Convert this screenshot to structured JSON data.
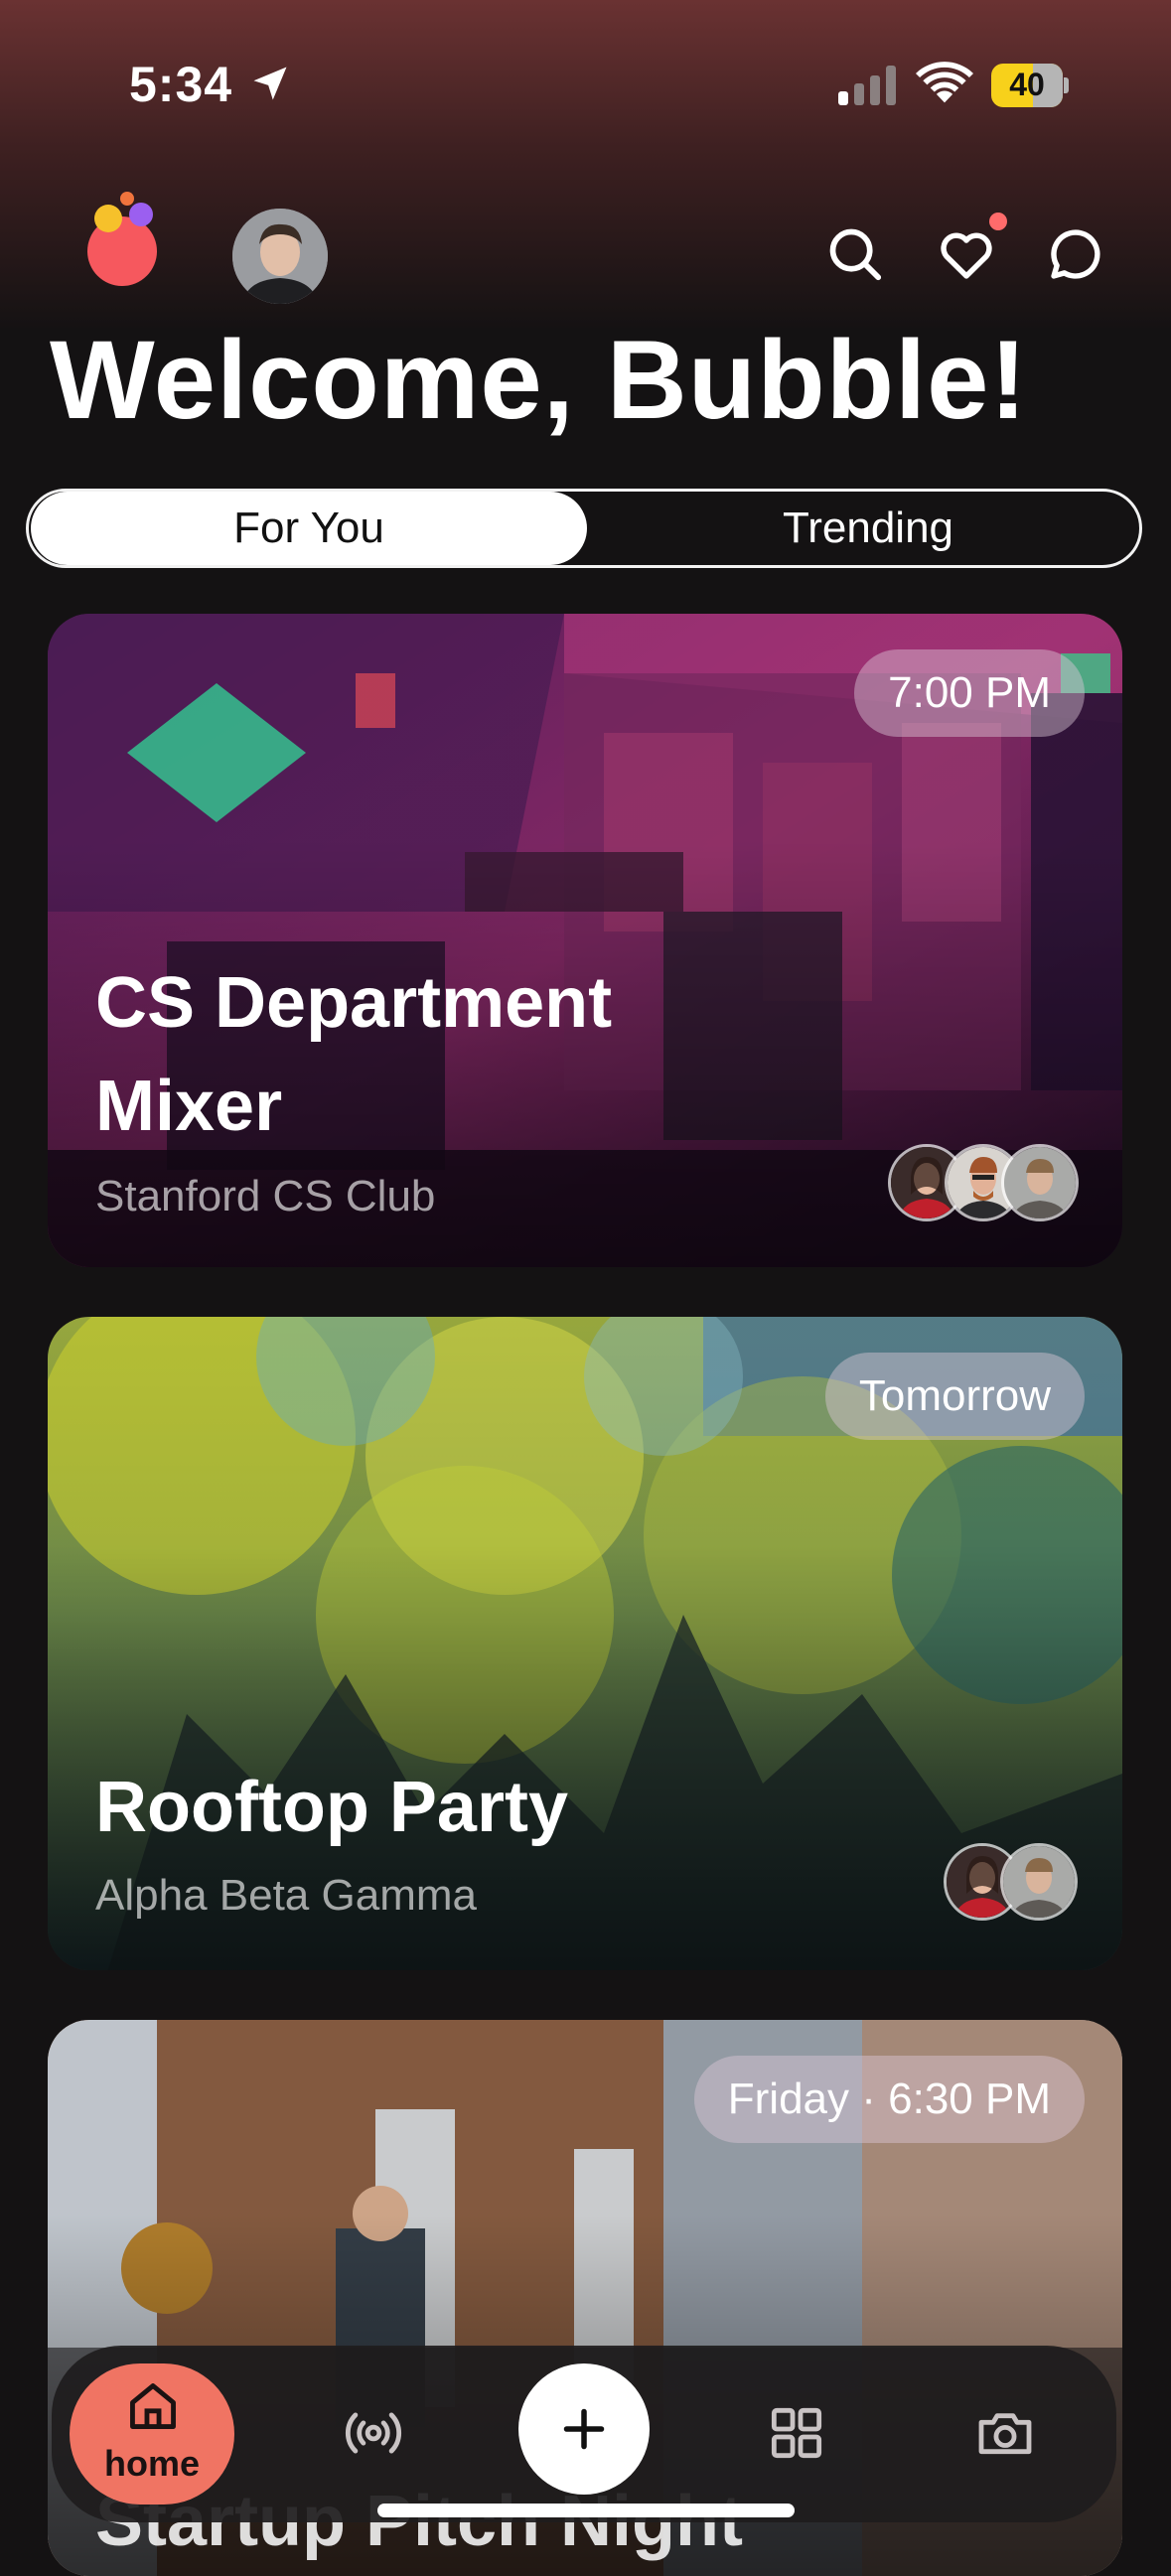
{
  "status_bar": {
    "time": "5:34",
    "battery": "40"
  },
  "header": {
    "title": "Welcome, Bubble!",
    "icons": [
      "search-icon",
      "heart-icon",
      "chat-icon"
    ]
  },
  "tabs": [
    {
      "label": "For You",
      "selected": true
    },
    {
      "label": "Trending",
      "selected": false
    }
  ],
  "events": [
    {
      "title_line1": "CS Department",
      "title_line2": "Mixer",
      "host": "Stanford CS Club",
      "time": "7:00 PM",
      "attendees": 3
    },
    {
      "title_line1": "Rooftop Party",
      "host": "Alpha Beta Gamma",
      "time": "Tomorrow",
      "attendees": 2
    },
    {
      "title_line1": "Startup Pitch Night",
      "time": "Friday · 6:30 PM"
    }
  ],
  "nav": {
    "home_label": "home",
    "items": [
      "home-icon",
      "broadcast-icon",
      "add-icon",
      "grid-icon",
      "camera-icon"
    ]
  },
  "colors": {
    "accent": "#f07463",
    "background": "#141213"
  }
}
